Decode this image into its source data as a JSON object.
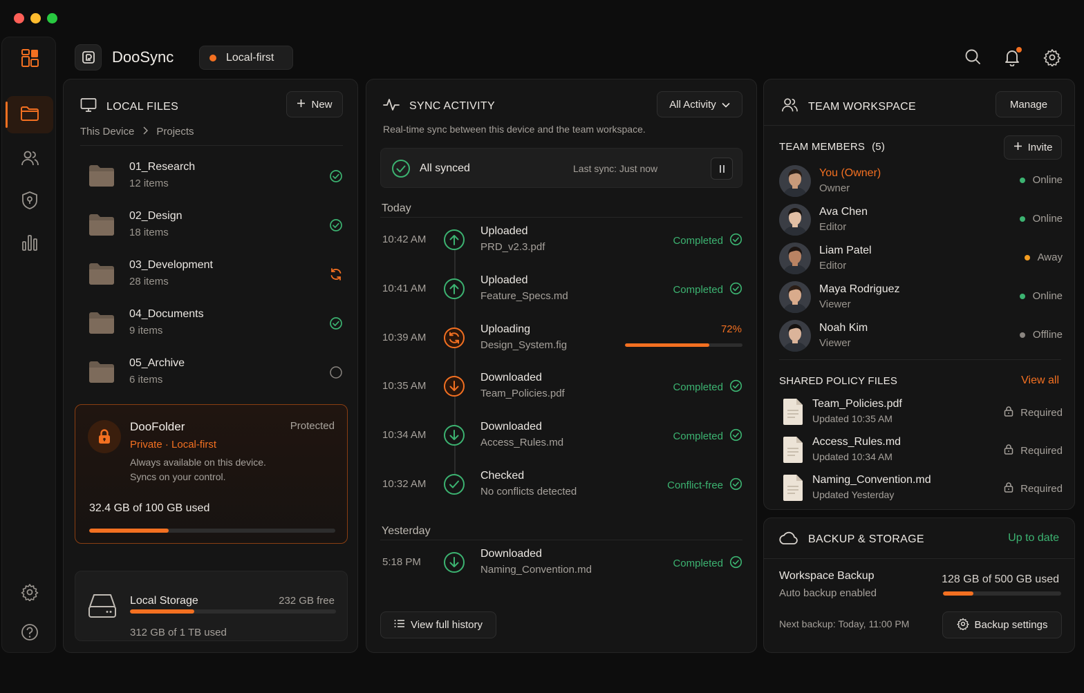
{
  "app": {
    "name": "DooSync",
    "mode_pill": "Local-first",
    "accent": "#f37021",
    "success": "#3cb371"
  },
  "sidebar": {
    "items": [
      {
        "icon": "folder-icon",
        "active": true
      },
      {
        "icon": "users-icon",
        "active": false
      },
      {
        "icon": "shield-icon",
        "active": false
      },
      {
        "icon": "chart-icon",
        "active": false
      }
    ],
    "bottom": [
      "gear-icon",
      "help-icon"
    ]
  },
  "top_icons": [
    "search-icon",
    "bell-icon",
    "gear-icon"
  ],
  "local_files": {
    "title": "LOCAL FILES",
    "new_label": "New",
    "breadcrumb": [
      "This Device",
      "Projects"
    ],
    "folders": [
      {
        "name": "01_Research",
        "count": "12 items",
        "status": "synced"
      },
      {
        "name": "02_Design",
        "count": "18 items",
        "status": "synced"
      },
      {
        "name": "03_Development",
        "count": "28 items",
        "status": "syncing"
      },
      {
        "name": "04_Documents",
        "count": "9 items",
        "status": "synced"
      },
      {
        "name": "05_Archive",
        "count": "6 items",
        "status": "idle"
      }
    ],
    "doofolder": {
      "name": "DooFolder",
      "badge": "Protected",
      "subtitle": "Private · Local-first",
      "line1": "Always available on this device.",
      "line2": "Syncs on your control.",
      "used": "32.4 GB of 100 GB used",
      "used_fraction": 0.324
    },
    "storage": {
      "name": "Local Storage",
      "free": "232 GB free",
      "used": "312 GB of 1 TB used",
      "used_fraction": 0.312
    }
  },
  "sync_activity": {
    "title": "SYNC ACTIVITY",
    "filter": "All Activity",
    "description": "Real-time sync between this device and the team workspace.",
    "status": {
      "text": "All synced",
      "last": "Last sync: Just now"
    },
    "today_label": "Today",
    "yesterday_label": "Yesterday",
    "today": [
      {
        "time": "10:42 AM",
        "action": "Uploaded",
        "file": "PRD_v2.3.pdf",
        "status": "Completed",
        "kind": "upload-done"
      },
      {
        "time": "10:41 AM",
        "action": "Uploaded",
        "file": "Feature_Specs.md",
        "status": "Completed",
        "kind": "upload-done"
      },
      {
        "time": "10:39 AM",
        "action": "Uploading",
        "file": "Design_System.fig",
        "status": "72%",
        "progress": 0.72,
        "kind": "uploading"
      },
      {
        "time": "10:35 AM",
        "action": "Downloaded",
        "file": "Team_Policies.pdf",
        "status": "Completed",
        "kind": "download-orange"
      },
      {
        "time": "10:34 AM",
        "action": "Downloaded",
        "file": "Access_Rules.md",
        "status": "Completed",
        "kind": "download-done"
      },
      {
        "time": "10:32 AM",
        "action": "Checked",
        "file": "No conflicts detected",
        "status": "Conflict-free",
        "kind": "check"
      }
    ],
    "yesterday": [
      {
        "time": "5:18 PM",
        "action": "Downloaded",
        "file": "Naming_Convention.md",
        "status": "Completed",
        "kind": "download-done"
      }
    ],
    "history_label": "View full history"
  },
  "team": {
    "title": "TEAM WORKSPACE",
    "manage_label": "Manage",
    "members_label": "TEAM MEMBERS",
    "members_count": "(5)",
    "invite_label": "Invite",
    "members": [
      {
        "name": "You (Owner)",
        "role": "Owner",
        "status": "Online",
        "dot": "#3cb371",
        "highlight": true,
        "skin": "#c89a7a",
        "hair": "#2a1e17"
      },
      {
        "name": "Ava Chen",
        "role": "Editor",
        "status": "Online",
        "dot": "#3cb371",
        "highlight": false,
        "skin": "#e2bfa4",
        "hair": "#1a1410"
      },
      {
        "name": "Liam Patel",
        "role": "Editor",
        "status": "Away",
        "dot": "#f39c21",
        "highlight": false,
        "skin": "#b98363",
        "hair": "#1c1512"
      },
      {
        "name": "Maya Rodriguez",
        "role": "Viewer",
        "status": "Online",
        "dot": "#3cb371",
        "highlight": false,
        "skin": "#d9ab8c",
        "hair": "#2b1d15"
      },
      {
        "name": "Noah Kim",
        "role": "Viewer",
        "status": "Offline",
        "dot": "#8a8580",
        "highlight": false,
        "skin": "#dbb49a",
        "hair": "#151210"
      }
    ],
    "policy_label": "SHARED POLICY FILES",
    "view_all": "View all",
    "policies": [
      {
        "name": "Team_Policies.pdf",
        "updated": "Updated 10:35 AM",
        "tag": "Required"
      },
      {
        "name": "Access_Rules.md",
        "updated": "Updated 10:34 AM",
        "tag": "Required"
      },
      {
        "name": "Naming_Convention.md",
        "updated": "Updated Yesterday",
        "tag": "Required"
      }
    ]
  },
  "backup": {
    "title": "BACKUP & STORAGE",
    "status": "Up to date",
    "name": "Workspace Backup",
    "auto": "Auto backup enabled",
    "used": "128 GB of 500 GB used",
    "used_fraction": 0.256,
    "next": "Next backup: Today, 11:00 PM",
    "settings_label": "Backup settings"
  }
}
